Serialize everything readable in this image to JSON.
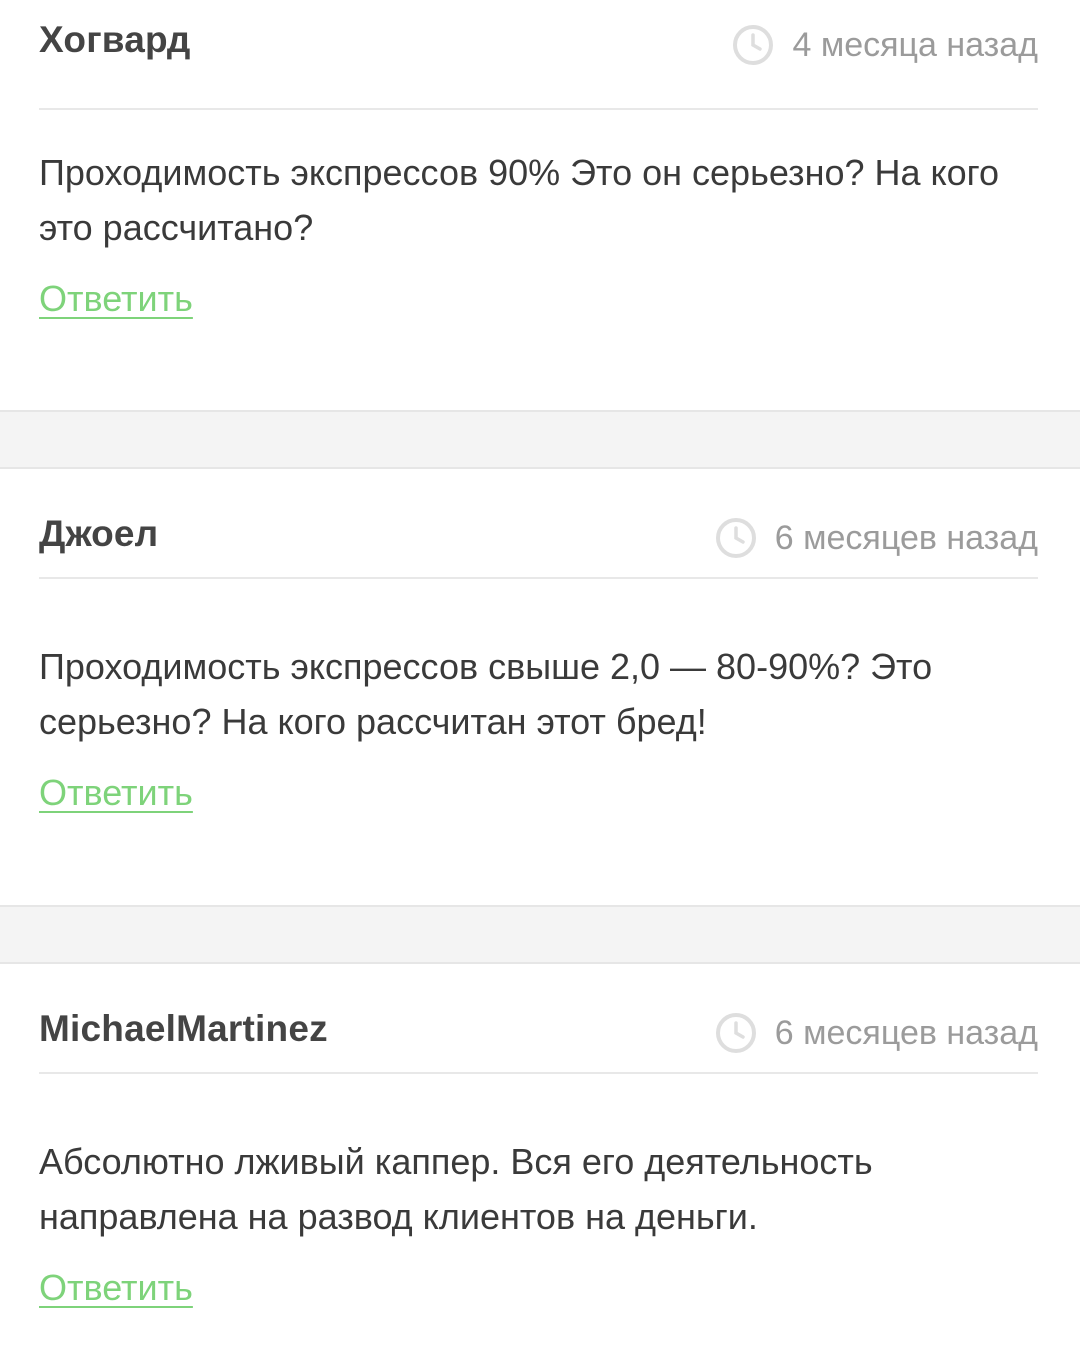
{
  "comments": [
    {
      "author": "Хогвард",
      "time": "4 месяца назад",
      "text": "Проходимость экспрессов 90% Это он серьезно? На кого это рассчитано?",
      "reply_label": "Ответить"
    },
    {
      "author": "Джоел",
      "time": "6 месяцев назад",
      "text": "Проходимость экспрессов свыше 2,0 — 80-90%? Это серьезно? На кого рассчитан этот бред!",
      "reply_label": "Ответить"
    },
    {
      "author": "MichaelMartinez",
      "time": "6 месяцев назад",
      "text": "Абсолютно лживый каппер. Вся его деятельность направлена на развод клиентов на деньги.",
      "reply_label": "Ответить"
    }
  ],
  "icons": {
    "time": "clock-icon"
  },
  "colors": {
    "link": "#7ed37a",
    "author": "#444444",
    "time": "#9b9b9b",
    "text": "#3a3a3a"
  }
}
